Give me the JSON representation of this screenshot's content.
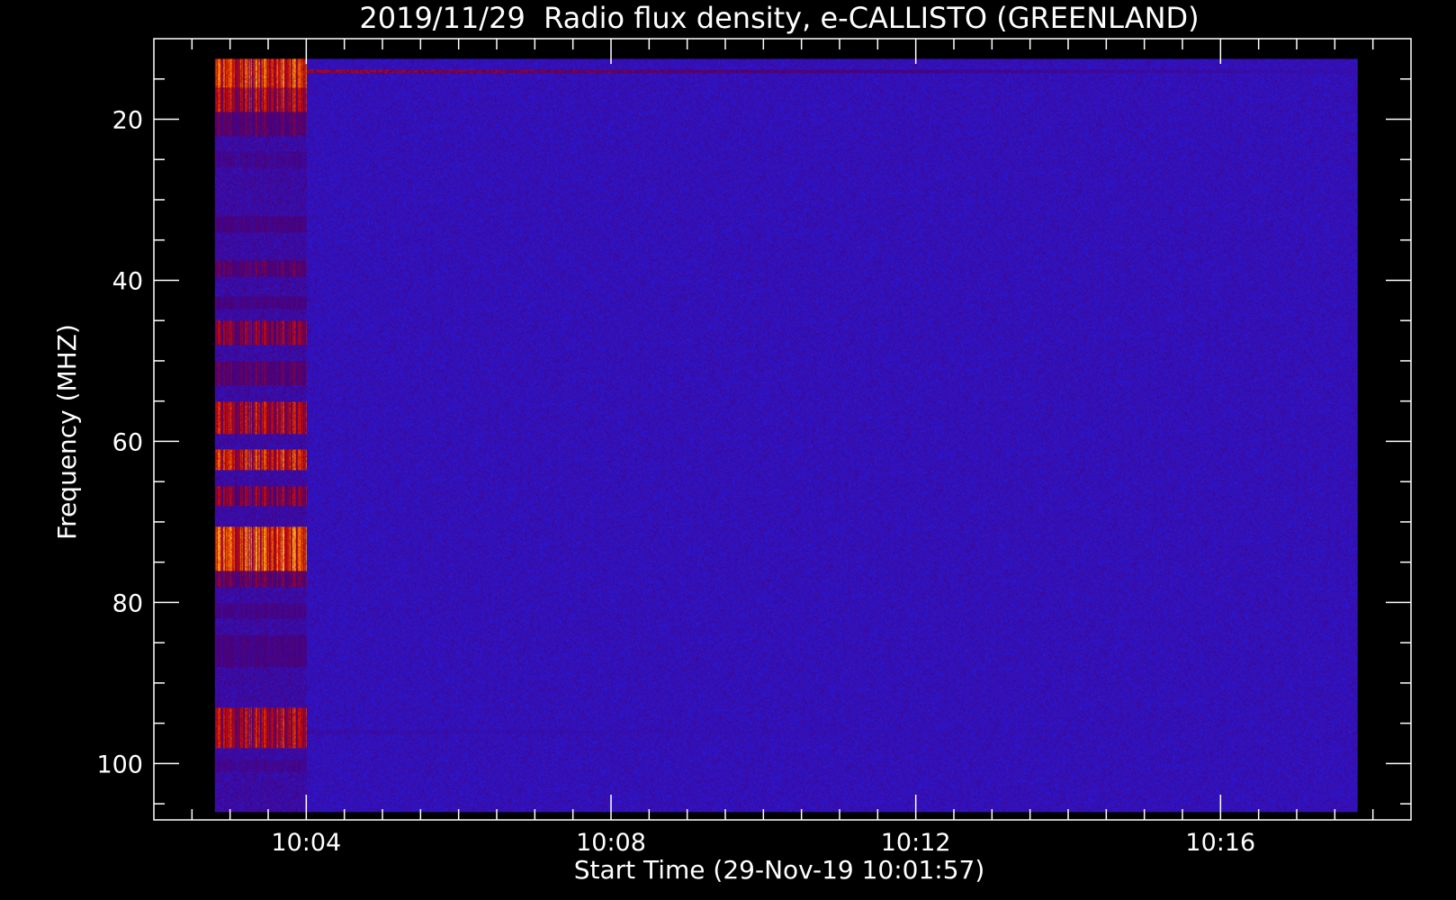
{
  "chart_data": {
    "type": "heatmap",
    "title": "2019/11/29  Radio flux density, e-CALLISTO (GREENLAND)",
    "xlabel": "Start Time (29-Nov-19 10:01:57)",
    "ylabel": "Frequency (MHZ)",
    "x_unit": "minutes since 10:00",
    "x_range": [
      2.0,
      18.5
    ],
    "y_range": [
      10,
      107
    ],
    "y_inverted": true,
    "data_x_range": [
      2.8,
      17.8
    ],
    "data_y_range": [
      12.5,
      106
    ],
    "x_ticks": [
      {
        "value": 4,
        "label": "10:04"
      },
      {
        "value": 8,
        "label": "10:08"
      },
      {
        "value": 12,
        "label": "10:12"
      },
      {
        "value": 16,
        "label": "10:16"
      }
    ],
    "x_minor_ticks": [
      2.5,
      3,
      3.5,
      4.5,
      5,
      5.5,
      6,
      6.5,
      7,
      7.5,
      8.5,
      9,
      9.5,
      10,
      10.5,
      11,
      11.5,
      12.5,
      13,
      13.5,
      14,
      14.5,
      15,
      15.5,
      16.5,
      17,
      17.5,
      18
    ],
    "y_ticks": [
      {
        "value": 20,
        "label": "20"
      },
      {
        "value": 40,
        "label": "40"
      },
      {
        "value": 60,
        "label": "60"
      },
      {
        "value": 80,
        "label": "80"
      },
      {
        "value": 100,
        "label": "100"
      }
    ],
    "y_minor_ticks": [
      15,
      25,
      30,
      35,
      45,
      50,
      55,
      65,
      70,
      75,
      85,
      90,
      95,
      105
    ],
    "background_level": "low",
    "burst_time_range": [
      2.8,
      4.0
    ],
    "burst_bands": [
      {
        "f_min": 12.5,
        "f_max": 16,
        "intensity": 0.9
      },
      {
        "f_min": 16,
        "f_max": 19,
        "intensity": 0.75
      },
      {
        "f_min": 19,
        "f_max": 22,
        "intensity": 0.5
      },
      {
        "f_min": 24,
        "f_max": 26,
        "intensity": 0.3
      },
      {
        "f_min": 32,
        "f_max": 34,
        "intensity": 0.4
      },
      {
        "f_min": 37.5,
        "f_max": 39.5,
        "intensity": 0.5
      },
      {
        "f_min": 42,
        "f_max": 43.5,
        "intensity": 0.4
      },
      {
        "f_min": 45,
        "f_max": 48,
        "intensity": 0.65
      },
      {
        "f_min": 50,
        "f_max": 53,
        "intensity": 0.5
      },
      {
        "f_min": 55,
        "f_max": 59,
        "intensity": 0.75
      },
      {
        "f_min": 61,
        "f_max": 63.5,
        "intensity": 0.85
      },
      {
        "f_min": 65.5,
        "f_max": 68,
        "intensity": 0.65
      },
      {
        "f_min": 70.5,
        "f_max": 76,
        "intensity": 0.95
      },
      {
        "f_min": 76,
        "f_max": 78,
        "intensity": 0.55
      },
      {
        "f_min": 80,
        "f_max": 82,
        "intensity": 0.35
      },
      {
        "f_min": 84,
        "f_max": 88,
        "intensity": 0.4
      },
      {
        "f_min": 93,
        "f_max": 98,
        "intensity": 0.75
      },
      {
        "f_min": 99.5,
        "f_max": 101,
        "intensity": 0.3
      }
    ],
    "persistent_lines": [
      {
        "freq": 14,
        "intensity": 0.6,
        "x_end": 17.8
      },
      {
        "freq": 96,
        "intensity": 0.25,
        "x_end": 17.8
      }
    ],
    "colors": {
      "background": "#000000",
      "axes": "#ffffff",
      "low": "#2020f0",
      "mid": "#b01000",
      "high": "#ffd000",
      "peak": "#ffffff"
    }
  }
}
